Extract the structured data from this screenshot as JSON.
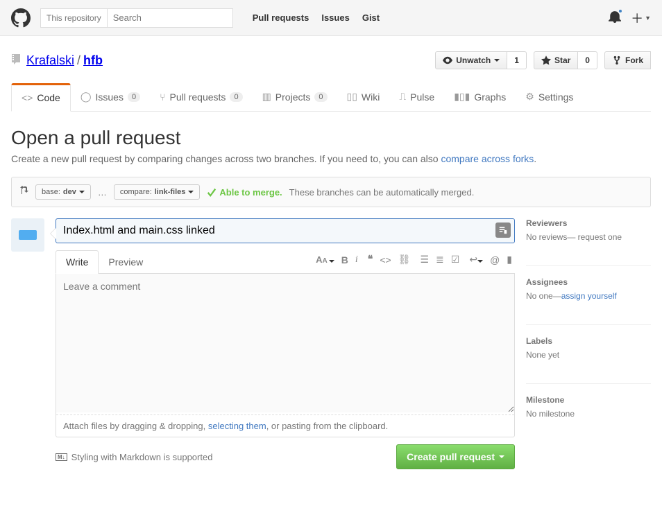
{
  "top": {
    "scope": "This repository",
    "placeholder": "Search",
    "nav": {
      "pr": "Pull requests",
      "issues": "Issues",
      "gist": "Gist"
    }
  },
  "repo": {
    "owner": "Krafalski",
    "name": "hfb",
    "unwatch_label": "Unwatch",
    "unwatch_count": "1",
    "star_label": "Star",
    "star_count": "0",
    "fork_label": "Fork"
  },
  "tabs": {
    "code": "Code",
    "issues": "Issues",
    "issues_count": "0",
    "pr": "Pull requests",
    "pr_count": "0",
    "projects": "Projects",
    "projects_count": "0",
    "wiki": "Wiki",
    "pulse": "Pulse",
    "graphs": "Graphs",
    "settings": "Settings"
  },
  "page": {
    "title": "Open a pull request",
    "subtitle_pre": "Create a new pull request by comparing changes across two branches. If you need to, you can also ",
    "subtitle_link": "compare across forks",
    "subtitle_post": "."
  },
  "range": {
    "base_label": "base: ",
    "base": "dev",
    "dots": "…",
    "compare_label": "compare: ",
    "compare": "link-files",
    "ok": "Able to merge.",
    "ok_tail": "These branches can be automatically merged."
  },
  "compose": {
    "title": "Index.html and main.css linked",
    "tab_write": "Write",
    "tab_preview": "Preview",
    "placeholder": "Leave a comment",
    "attach_pre": "Attach files by dragging & dropping, ",
    "attach_link": "selecting them",
    "attach_post": ", or pasting from the clipboard.",
    "md": "Styling with Markdown is supported",
    "submit": "Create pull request"
  },
  "side": {
    "reviewers_label": "Reviewers",
    "reviewers_value": "No reviews— request one",
    "assignees_label": "Assignees",
    "assignees_value_pre": "No one—",
    "assignees_link": "assign yourself",
    "labels_label": "Labels",
    "labels_value": "None yet",
    "milestone_label": "Milestone",
    "milestone_value": "No milestone"
  }
}
